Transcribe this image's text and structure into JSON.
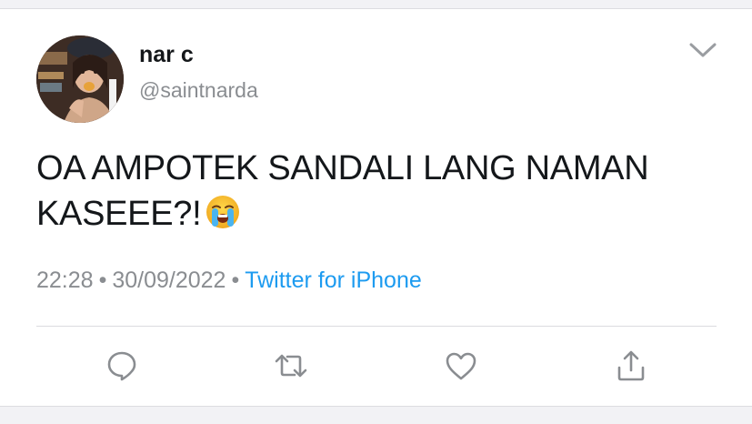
{
  "tweet": {
    "display_name": "nar c",
    "handle": "@saintnarda",
    "text_line1": "OA AMPOTEK SANDALI LANG NAMAN",
    "text_line2": "KASEEE?!",
    "emoji": "loudly-crying-face",
    "time": "22:28",
    "separator": "•",
    "date": "30/09/2022",
    "source": "Twitter for iPhone"
  },
  "actions": [
    {
      "name": "reply",
      "icon": "reply-icon"
    },
    {
      "name": "retweet",
      "icon": "retweet-icon"
    },
    {
      "name": "like",
      "icon": "heart-icon"
    },
    {
      "name": "share",
      "icon": "share-icon"
    }
  ],
  "colors": {
    "text": "#14171a",
    "secondary": "#8a8d91",
    "link": "#1d9bf0",
    "icon": "#8a8d91",
    "background": "#ffffff"
  }
}
